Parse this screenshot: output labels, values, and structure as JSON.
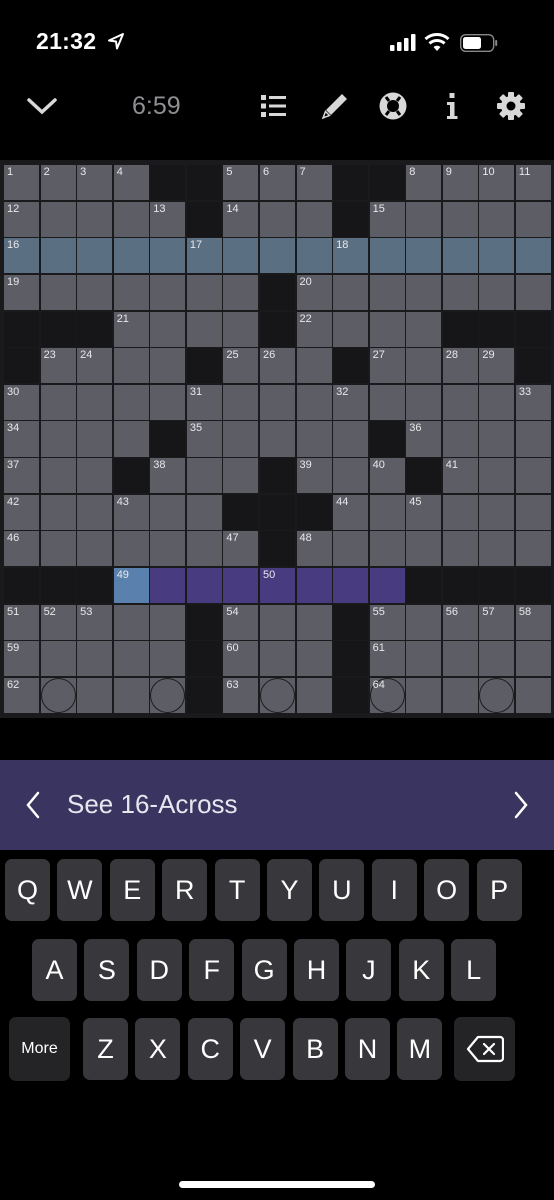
{
  "status_bar": {
    "time": "21:32"
  },
  "toolbar": {
    "timer": "6:59",
    "icons": [
      "chevron-down-icon",
      "list-icon",
      "pencil-icon",
      "lifebuoy-icon",
      "info-icon",
      "gear-icon"
    ]
  },
  "colors": {
    "cell": "#5d5d66",
    "black_cell": "#161618",
    "highlight_word": "#5b6f82",
    "selected_word": "#483b80",
    "selected_cell": "#5a80ad",
    "clue_bar": "#3a3460"
  },
  "puzzle": {
    "size": 15,
    "rows": [
      "....##...##....",
      ".....#...#.....",
      "...............",
      ".......#.......",
      "###....#....###",
      "#....#...#....#",
      "...............",
      "....#.....#....",
      "...#...#...#...",
      "......###......",
      ".......#.......",
      "###........####",
      ".....#...#.....",
      ".....#...#.....",
      ".....#...#....."
    ],
    "numbers": [
      [
        0,
        0,
        "1"
      ],
      [
        0,
        1,
        "2"
      ],
      [
        0,
        2,
        "3"
      ],
      [
        0,
        3,
        "4"
      ],
      [
        0,
        6,
        "5"
      ],
      [
        0,
        7,
        "6"
      ],
      [
        0,
        8,
        "7"
      ],
      [
        0,
        11,
        "8"
      ],
      [
        0,
        12,
        "9"
      ],
      [
        0,
        13,
        "10"
      ],
      [
        0,
        14,
        "11"
      ],
      [
        1,
        0,
        "12"
      ],
      [
        1,
        4,
        "13"
      ],
      [
        1,
        6,
        "14"
      ],
      [
        1,
        10,
        "15"
      ],
      [
        2,
        0,
        "16"
      ],
      [
        2,
        5,
        "17"
      ],
      [
        2,
        9,
        "18"
      ],
      [
        3,
        0,
        "19"
      ],
      [
        3,
        8,
        "20"
      ],
      [
        4,
        3,
        "21"
      ],
      [
        4,
        8,
        "22"
      ],
      [
        5,
        1,
        "23"
      ],
      [
        5,
        2,
        "24"
      ],
      [
        5,
        6,
        "25"
      ],
      [
        5,
        7,
        "26"
      ],
      [
        5,
        10,
        "27"
      ],
      [
        5,
        12,
        "28"
      ],
      [
        5,
        13,
        "29"
      ],
      [
        6,
        0,
        "30"
      ],
      [
        6,
        5,
        "31"
      ],
      [
        6,
        9,
        "32"
      ],
      [
        6,
        14,
        "33"
      ],
      [
        7,
        0,
        "34"
      ],
      [
        7,
        5,
        "35"
      ],
      [
        7,
        11,
        "36"
      ],
      [
        8,
        0,
        "37"
      ],
      [
        8,
        4,
        "38"
      ],
      [
        8,
        8,
        "39"
      ],
      [
        8,
        10,
        "40"
      ],
      [
        8,
        12,
        "41"
      ],
      [
        9,
        0,
        "42"
      ],
      [
        9,
        3,
        "43"
      ],
      [
        9,
        9,
        "44"
      ],
      [
        9,
        11,
        "45"
      ],
      [
        10,
        0,
        "46"
      ],
      [
        10,
        6,
        "47"
      ],
      [
        10,
        8,
        "48"
      ],
      [
        11,
        3,
        "49"
      ],
      [
        11,
        7,
        "50"
      ],
      [
        12,
        0,
        "51"
      ],
      [
        12,
        1,
        "52"
      ],
      [
        12,
        2,
        "53"
      ],
      [
        12,
        6,
        "54"
      ],
      [
        12,
        10,
        "55"
      ],
      [
        12,
        12,
        "56"
      ],
      [
        12,
        13,
        "57"
      ],
      [
        12,
        14,
        "58"
      ],
      [
        13,
        0,
        "59"
      ],
      [
        13,
        6,
        "60"
      ],
      [
        13,
        10,
        "61"
      ],
      [
        14,
        0,
        "62"
      ],
      [
        14,
        6,
        "63"
      ],
      [
        14,
        10,
        "64"
      ]
    ],
    "circles": [
      [
        14,
        1
      ],
      [
        14,
        4
      ],
      [
        14,
        7
      ],
      [
        14,
        10
      ],
      [
        14,
        13
      ]
    ],
    "highlighted_row": 2,
    "selected_word": {
      "row": 11,
      "from_col": 3,
      "to_col": 11
    },
    "selected_cell": [
      11,
      3
    ]
  },
  "clue_bar": {
    "text": "See 16-Across",
    "prev_icon": "chevron-left-icon",
    "next_icon": "chevron-right-icon"
  },
  "keyboard": {
    "row1": [
      "Q",
      "W",
      "E",
      "R",
      "T",
      "Y",
      "U",
      "I",
      "O",
      "P"
    ],
    "row2": [
      "A",
      "S",
      "D",
      "F",
      "G",
      "H",
      "J",
      "K",
      "L"
    ],
    "row3": [
      "Z",
      "X",
      "C",
      "V",
      "B",
      "N",
      "M"
    ],
    "more_label": "More",
    "delete_icon": "backspace-icon"
  }
}
